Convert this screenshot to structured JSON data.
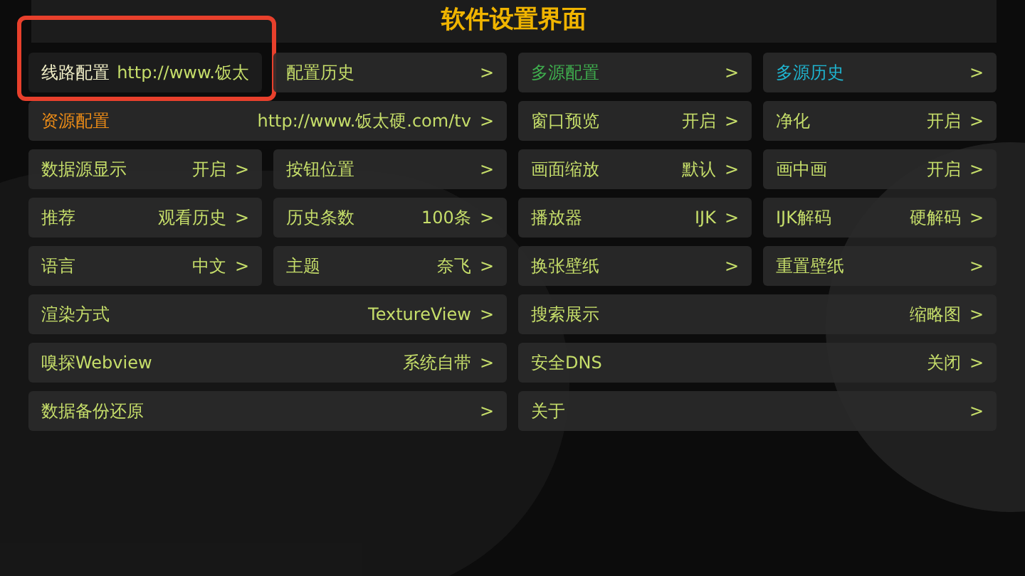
{
  "title": "软件设置界面",
  "items": [
    {
      "kind": "half",
      "label": "线路配置",
      "value": "http://www.饭太",
      "highlighted": true,
      "color": "#f2f0c8"
    },
    {
      "kind": "half",
      "label": "配置历史",
      "arrow": ">",
      "highlighted": false
    },
    {
      "kind": "half",
      "label": "多源配置",
      "arrow": ">",
      "highlighted": false,
      "color": "#3fae4e"
    },
    {
      "kind": "half",
      "label": "多源历史",
      "arrow": ">",
      "highlighted": false,
      "color": "#1fb4cf"
    },
    {
      "kind": "wide",
      "label": "资源配置",
      "value": "http://www.饭太硬.com/tv",
      "arrow": ">",
      "highlighted": false,
      "color": "#ec8c17"
    },
    {
      "kind": "half",
      "label": "窗口预览",
      "value": "开启",
      "arrow": ">",
      "highlighted": false
    },
    {
      "kind": "half",
      "label": "净化",
      "value": "开启",
      "arrow": ">",
      "highlighted": false
    },
    {
      "kind": "half",
      "label": "数据源显示",
      "value": "开启",
      "arrow": ">",
      "highlighted": false
    },
    {
      "kind": "half",
      "label": "按钮位置",
      "arrow": ">",
      "highlighted": false
    },
    {
      "kind": "half",
      "label": "画面缩放",
      "value": "默认",
      "arrow": ">",
      "highlighted": false
    },
    {
      "kind": "half",
      "label": "画中画",
      "value": "开启",
      "arrow": ">",
      "highlighted": false
    },
    {
      "kind": "half",
      "label": "推荐",
      "value": "观看历史",
      "arrow": ">",
      "highlighted": false
    },
    {
      "kind": "half",
      "label": "历史条数",
      "value": "100条",
      "arrow": ">",
      "highlighted": false
    },
    {
      "kind": "half",
      "label": "播放器",
      "value": "IJK",
      "arrow": ">",
      "highlighted": false
    },
    {
      "kind": "half",
      "label": "IJK解码",
      "value": "硬解码",
      "arrow": ">",
      "highlighted": false
    },
    {
      "kind": "half",
      "label": "语言",
      "value": "中文",
      "arrow": ">",
      "highlighted": false
    },
    {
      "kind": "half",
      "label": "主题",
      "value": "奈飞",
      "arrow": ">",
      "highlighted": false
    },
    {
      "kind": "half",
      "label": "换张壁纸",
      "arrow": ">",
      "highlighted": false
    },
    {
      "kind": "half",
      "label": "重置壁纸",
      "arrow": ">",
      "highlighted": false
    },
    {
      "kind": "wide",
      "label": "渲染方式",
      "value": "TextureView",
      "arrow": ">",
      "highlighted": false
    },
    {
      "kind": "wide",
      "label": "搜索展示",
      "value": "缩略图",
      "arrow": ">",
      "highlighted": false
    },
    {
      "kind": "wide",
      "label": "嗅探Webview",
      "value": "系统自带",
      "arrow": ">",
      "highlighted": false
    },
    {
      "kind": "wide",
      "label": "安全DNS",
      "value": "关闭",
      "arrow": ">",
      "highlighted": false
    },
    {
      "kind": "wide",
      "label": "数据备份还原",
      "arrow": ">",
      "highlighted": false
    },
    {
      "kind": "wide",
      "label": "关于",
      "arrow": ">",
      "highlighted": false
    }
  ]
}
